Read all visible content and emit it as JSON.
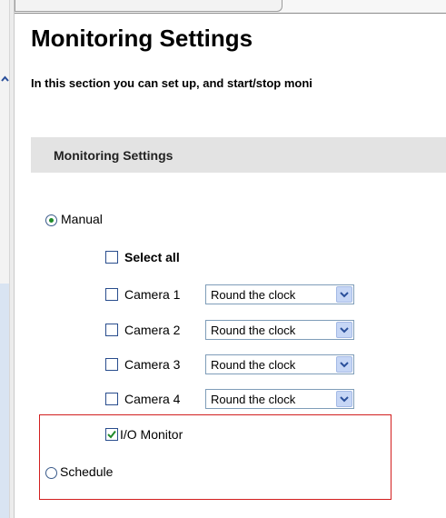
{
  "title": "Monitoring Settings",
  "intro": "In this section you can set up, and start/stop moni",
  "section_header": "Monitoring Settings",
  "manual": {
    "label": "Manual",
    "selected": true
  },
  "select_all": {
    "label": "Select all",
    "checked": false
  },
  "cameras": [
    {
      "label": "Camera 1",
      "checked": false,
      "mode": "Round the clock"
    },
    {
      "label": "Camera 2",
      "checked": false,
      "mode": "Round the clock"
    },
    {
      "label": "Camera 3",
      "checked": false,
      "mode": "Round the clock"
    },
    {
      "label": "Camera 4",
      "checked": false,
      "mode": "Round the clock"
    }
  ],
  "io_monitor": {
    "label": "I/O Monitor",
    "checked": true
  },
  "schedule": {
    "label": "Schedule",
    "selected": false
  },
  "colors": {
    "highlight_border": "#d21f1f",
    "section_bg": "#e3e3e3",
    "check_green": "#1f8a2a"
  },
  "icons": {
    "scroll_up": "chevron-up-icon",
    "dropdown": "chevron-down-icon",
    "check": "checkmark-icon"
  }
}
